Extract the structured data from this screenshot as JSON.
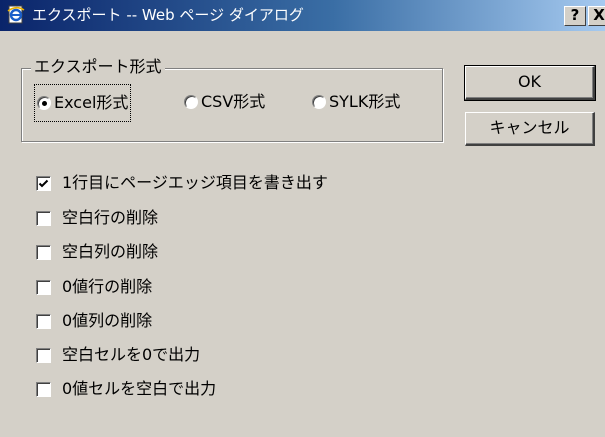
{
  "window": {
    "title": "エクスポート -- Web ページ ダイアログ",
    "help_label": "?",
    "close_label": "X"
  },
  "format_group": {
    "legend": "エクスポート形式",
    "options": [
      {
        "label": "Excel形式",
        "selected": true
      },
      {
        "label": "CSV形式",
        "selected": false
      },
      {
        "label": "SYLK形式",
        "selected": false
      }
    ]
  },
  "buttons": {
    "ok_label": "OK",
    "cancel_label": "キャンセル"
  },
  "options": [
    {
      "label": "1行目にページエッジ項目を書き出す",
      "checked": true
    },
    {
      "label": "空白行の削除",
      "checked": false
    },
    {
      "label": "空白列の削除",
      "checked": false
    },
    {
      "label": "0値行の削除",
      "checked": false
    },
    {
      "label": "0値列の削除",
      "checked": false
    },
    {
      "label": "空白セルを0で出力",
      "checked": false
    },
    {
      "label": "0値セルを空白で出力",
      "checked": false
    }
  ],
  "colors": {
    "face": "#d4d0c8",
    "title_start": "#0a246a",
    "title_end": "#a6caf0"
  },
  "icons": {
    "app": "ie-page-icon",
    "check": "checkmark-icon"
  }
}
